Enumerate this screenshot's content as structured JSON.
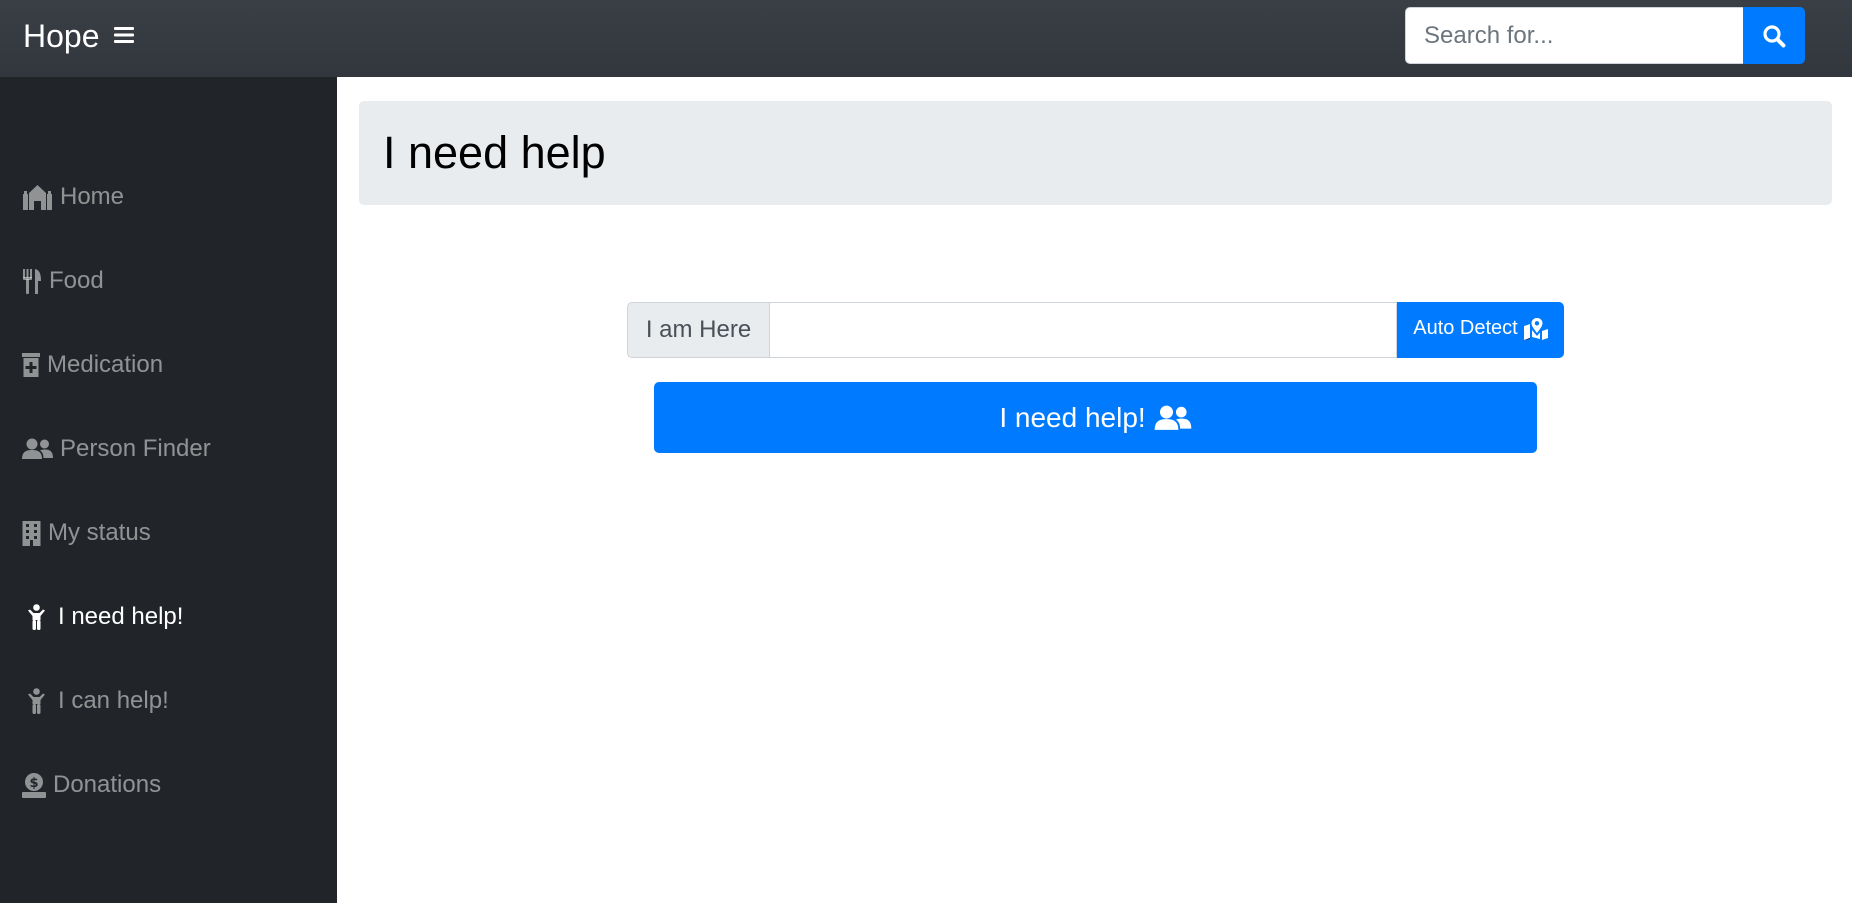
{
  "header": {
    "brand": "Hope",
    "menu_icon": "hamburger-icon",
    "search": {
      "placeholder": "Search for...",
      "value": "",
      "button_icon": "search-icon"
    }
  },
  "sidebar": {
    "items": [
      {
        "label": "Home",
        "icon": "home-icon",
        "active": false
      },
      {
        "label": "Food",
        "icon": "utensils-icon",
        "active": false
      },
      {
        "label": "Medication",
        "icon": "prescription-bottle-icon",
        "active": false
      },
      {
        "label": "Person Finder",
        "icon": "users-icon",
        "active": false
      },
      {
        "label": "My status",
        "icon": "building-icon",
        "active": false
      },
      {
        "label": "I need help!",
        "icon": "child-icon",
        "active": true
      },
      {
        "label": "I can help!",
        "icon": "child-icon",
        "active": false
      },
      {
        "label": "Donations",
        "icon": "donate-icon",
        "active": false
      }
    ]
  },
  "main": {
    "title": "I need help",
    "location": {
      "label": "I am Here",
      "value": "",
      "auto_detect_label": "Auto Detect",
      "auto_detect_icon": "map-marked-icon"
    },
    "submit": {
      "label": "I need help!",
      "icon": "users-icon"
    }
  },
  "colors": {
    "primary": "#007bff",
    "sidebar_bg": "#212529",
    "topbar_bg": "#343a40",
    "jumbotron_bg": "#e9ecef"
  }
}
